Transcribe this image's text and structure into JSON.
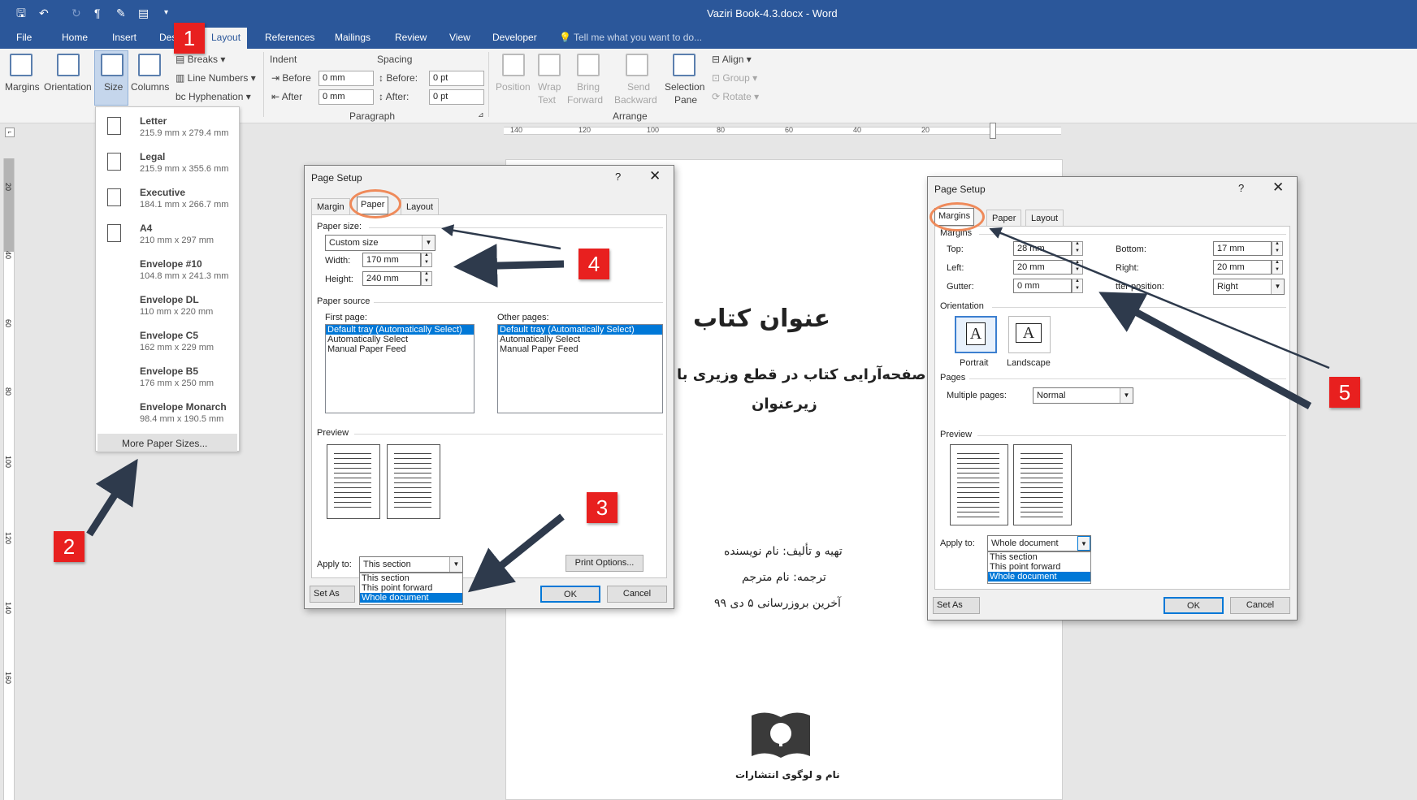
{
  "window": {
    "title": "Vaziri Book-4.3.docx  -  Word"
  },
  "ribbon_tabs": [
    "File",
    "Home",
    "Insert",
    "Des",
    "Layout",
    "References",
    "Mailings",
    "Review",
    "View",
    "Developer"
  ],
  "tell_me": "Tell me what you want to do...",
  "ribbon": {
    "margins": "Margins",
    "orientation": "Orientation",
    "size": "Size",
    "columns": "Columns",
    "breaks": "Breaks",
    "line_numbers": "Line Numbers",
    "hyphenation": "Hyphenation",
    "indent": "Indent",
    "before": "Before",
    "after": "After",
    "indent_before_val": "0 mm",
    "indent_after_val": "0 mm",
    "spacing": "Spacing",
    "sp_before": "Before:",
    "sp_after": "After:",
    "sp_before_val": "0 pt",
    "sp_after_val": "0 pt",
    "paragraph": "Paragraph",
    "position": "Position",
    "wrap_text_1": "Wrap",
    "wrap_text_2": "Text",
    "bring_forward_1": "Bring",
    "bring_forward_2": "Forward",
    "send_backward_1": "Send",
    "send_backward_2": "Backward",
    "selection_pane_1": "Selection",
    "selection_pane_2": "Pane",
    "align": "Align",
    "group": "Group",
    "rotate": "Rotate",
    "arrange": "Arrange"
  },
  "ruler": [
    "140",
    "120",
    "100",
    "80",
    "60",
    "40",
    "20"
  ],
  "vruler": [
    "20",
    "40",
    "60",
    "80",
    "100",
    "120",
    "140",
    "160"
  ],
  "size_menu": {
    "items": [
      {
        "name": "Letter",
        "dims": "215.9 mm x 279.4 mm"
      },
      {
        "name": "Legal",
        "dims": "215.9 mm x 355.6 mm"
      },
      {
        "name": "Executive",
        "dims": "184.1 mm x 266.7 mm"
      },
      {
        "name": "A4",
        "dims": "210 mm x 297 mm"
      },
      {
        "name": "Envelope #10",
        "dims": "104.8 mm x 241.3 mm"
      },
      {
        "name": "Envelope DL",
        "dims": "110 mm x 220 mm"
      },
      {
        "name": "Envelope C5",
        "dims": "162 mm x 229 mm"
      },
      {
        "name": "Envelope B5",
        "dims": "176 mm x 250 mm"
      },
      {
        "name": "Envelope Monarch",
        "dims": "98.4 mm x 190.5 mm"
      }
    ],
    "more": "More Paper Sizes..."
  },
  "document": {
    "title": "عنوان کتاب",
    "subtitle": "صفحه‌آرایی کتاب در قطع وزیری با",
    "sub2": "زیرعنوان",
    "author": "تهیه و تألیف: نام نویسنده",
    "translator": "ترجمه: نام مترجم",
    "updated": "آخرین بروزرسانی ۵ دی ۹۹",
    "publisher": "نام و لوگوی انتشارات"
  },
  "dialog_paper": {
    "title": "Page Setup",
    "help": "?",
    "close": "✕",
    "tabs": [
      "Margin",
      "Paper",
      "Layout"
    ],
    "paper_size": "Paper size:",
    "paper_size_val": "Custom size",
    "width": "Width:",
    "width_val": "170 mm",
    "height": "Height:",
    "height_val": "240 mm",
    "paper_source": "Paper source",
    "first_page": "First page:",
    "other_pages": "Other pages:",
    "trays": [
      "Default tray (Automatically Select)",
      "Automatically Select",
      "Manual Paper Feed"
    ],
    "preview": "Preview",
    "apply_to": "Apply to:",
    "apply_val": "This section",
    "apply_options": [
      "This section",
      "This point forward",
      "Whole document"
    ],
    "print_options": "Print Options...",
    "set_default": "Set As Defa",
    "ok": "OK",
    "cancel": "Cancel"
  },
  "dialog_margins": {
    "title": "Page Setup",
    "help": "?",
    "close": "✕",
    "tabs": [
      "Margins",
      "Paper",
      "Layout"
    ],
    "margins": "Margins",
    "top": "Top:",
    "top_val": "28 mm",
    "bottom": "Bottom:",
    "bottom_val": "17 mm",
    "left": "Left:",
    "left_val": "20 mm",
    "right": "Right:",
    "right_val": "20 mm",
    "gutter": "Gutter:",
    "gutter_val": "0 mm",
    "gutter_pos": "tter position:",
    "gutter_pos_val": "Right",
    "orientation": "Orientation",
    "portrait": "Portrait",
    "landscape": "Landscape",
    "glyph": "A",
    "pages": "Pages",
    "multiple_pages": "Multiple pages:",
    "multiple_val": "Normal",
    "preview": "Preview",
    "apply_to": "Apply to:",
    "apply_val": "Whole document",
    "apply_options": [
      "This section",
      "This point forward",
      "Whole document"
    ],
    "set_default": "Set As Defa",
    "ok": "OK",
    "cancel": "Cancel"
  },
  "callouts": [
    "1",
    "2",
    "3",
    "4",
    "5"
  ],
  "colors": {
    "word_blue": "#2b579a",
    "callout_red": "#e8201f",
    "highlight_orange": "#ef8a5a",
    "arrow": "#2e3a4c"
  }
}
